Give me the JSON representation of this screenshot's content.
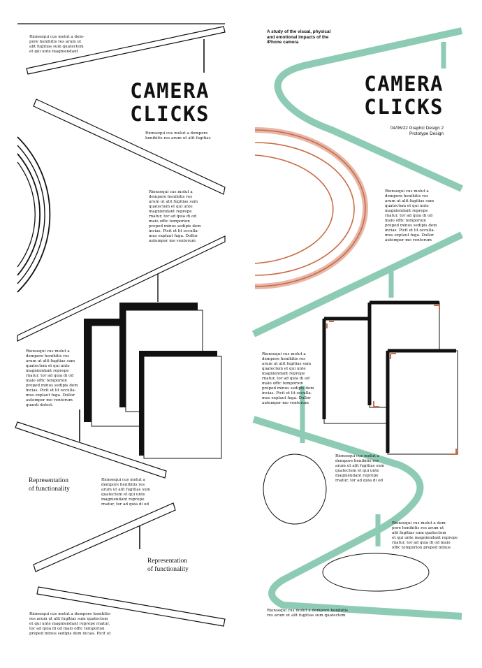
{
  "left": {
    "title": "CAMERA\nCLICKS",
    "blocks": [
      "Rionsequi cus molut a dem-\npore henihitis res arum ut\nalit fugitias sum quatectem\net qui unte magniendant",
      "Rionsequi cus molut a dempore\nhenihitis res arum ut alit fugitias",
      "Rionsequi cus molut a\ndempore henihitis res\narum ut alit fugitias sum\nquatectem et qui unte\nmagniendant reprepe\nrnatur, tor ad quia di od\nmaio offic temporion\npreped minus sedipis dem\nincias. Picit et lit occulla-\nmus explaut fuga. Dollor\nautempor mo ventorum",
      "Rionsequi cus molut a\ndempore henihitis res\narum ut alit fugitias sum\nquatectem et qui unte\nmagniendant reprepe\nrnatur, tor ad quia di od\nmaio offic temporion\npreped minus sedipis dem\nincias. Picit et lit occulla-\nmus explaut fuga. Dollor\nautempor mo ventorum\nquunti dolest.",
      "Rionsequi cus molut a\ndempore henihitis res\narum ut alit fugitias sum\nquatectem et qui unte\nmagniendant reprepe\nrnatur, tor ad quia di od",
      "Rionsequi cus molut a dempore henihitis\nres arum ut alit fugitias sum quatectem\net qui unte magniendant reprepe rnatur,\ntor ad quia di od maio offic temporion\npreped minus sedipis dem incias. Picit et"
    ],
    "labels": [
      "Representation\nof functionality",
      "Representation\nof functionality"
    ]
  },
  "right": {
    "intro": "A study of the visual, physical\nand emotional impacts of the\niPhone camera",
    "title": "CAMERA\nCLICKS",
    "subtitle": "04/06/22 Graphic Design 2\nPrototype Design",
    "blocks": [
      "Rionsequi cus molut a\ndempore henihitis res\narum ut alit fugitias sum\nquatectem et qui unte\nmagniendant reprepe\nrnatur, tor ad quia di od\nmaio offic temporion\npreped minus sedipis dem\nincias. Picit et lit occulla-\nmus explaut fuga. Dollor\nautempor mo ventorum",
      "Rionsequi cus molut a\ndempore henihitis res\narum ut alit fugitias sum\nquatectem et qui unte\nmagniendant reprepe\nrnatur, tor ad quia di od\nmaio offic temporion\npreped minus sedipis dem\nincias. Picit et lit occulla-\nmus explaut fuga. Dollor\nautempor mo ventorum",
      "Rionsequi cus molut a\ndempore henihitis res\narum ut alit fugitias sum\nquatectem et qui unte\nmagniendant reprepe\nrnatur, tor ad quia di od",
      "Rionsequi cus molut a dem-\npore henihitis res arum ut\nalit fugitias sum quatectem\net qui unte magniendant reprepe\nrnatur, tor ad quia di od maio\noffic temporion preped minus",
      "Rionsequi cus molut a dempore henihitis\nres arum ut alit fugitias sum quatectem"
    ]
  },
  "colors": {
    "ink": "#111111",
    "teal": "#8ecbb4",
    "rust": "#c96b45",
    "rust_light": "#e7b7a9"
  }
}
